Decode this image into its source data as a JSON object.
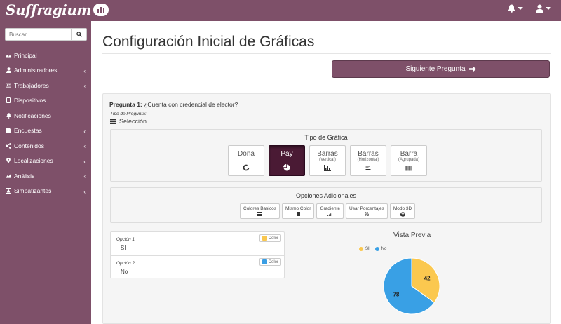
{
  "app": {
    "name": "Suffragium"
  },
  "sidebar": {
    "search_placeholder": "Buscar...",
    "items": [
      {
        "label": "Principal",
        "icon": "dashboard-icon",
        "submenu": false
      },
      {
        "label": "Administradores",
        "icon": "user-icon",
        "submenu": true
      },
      {
        "label": "Trabajadores",
        "icon": "id-card-icon",
        "submenu": true
      },
      {
        "label": "Dispositivos",
        "icon": "tablet-icon",
        "submenu": false
      },
      {
        "label": "Notificaciones",
        "icon": "bell-icon",
        "submenu": false
      },
      {
        "label": "Encuestas",
        "icon": "file-icon",
        "submenu": true
      },
      {
        "label": "Contenidos",
        "icon": "share-icon",
        "submenu": true
      },
      {
        "label": "Localizaciones",
        "icon": "map-marker-icon",
        "submenu": true
      },
      {
        "label": "Análisis",
        "icon": "area-chart-icon",
        "submenu": true
      },
      {
        "label": "Simpatizantes",
        "icon": "contact-card-icon",
        "submenu": true
      }
    ]
  },
  "main": {
    "title": "Configuración Inicial de Gráficas",
    "next_button": "Siguiente Pregunta",
    "question": {
      "prefix": "Pregunta 1:",
      "text": "¿Cuenta con credencial de elector?",
      "type_label": "Tipo de Pregunta:",
      "type_value": "Selección"
    },
    "chart_type": {
      "title": "Tipo de Gráfica",
      "options": [
        {
          "name": "Dona",
          "sub": "",
          "icon": "donut-icon",
          "active": false
        },
        {
          "name": "Pay",
          "sub": "",
          "icon": "pie-icon",
          "active": true
        },
        {
          "name": "Barras",
          "sub": "(Vertical)",
          "icon": "bar-vertical-icon",
          "active": false
        },
        {
          "name": "Barras",
          "sub": "(Horizontal)",
          "icon": "bar-horizontal-icon",
          "active": false
        },
        {
          "name": "Barra",
          "sub": "(Agrupada)",
          "icon": "bar-grouped-icon",
          "active": false
        }
      ]
    },
    "additional": {
      "title": "Opciones Adicionales",
      "options": [
        {
          "label": "Colores Basicos",
          "icon": "list-icon"
        },
        {
          "label": "Mismo Color",
          "icon": "square-icon"
        },
        {
          "label": "Gradiente",
          "icon": "signal-icon"
        },
        {
          "label": "Usar Porcentajes",
          "icon": "percent-icon"
        },
        {
          "label": "Modo 3D",
          "icon": "cube-icon"
        }
      ]
    },
    "answers": [
      {
        "label": "Opción 1",
        "value": "SI",
        "color_button": "Color",
        "color": "#f9c74f"
      },
      {
        "label": "Opción 2",
        "value": "No",
        "color_button": "Color",
        "color": "#3a9ee4"
      }
    ],
    "preview": {
      "title": "Vista Previa"
    }
  },
  "chart_data": {
    "type": "pie",
    "categories": [
      "SI",
      "No"
    ],
    "values": [
      42,
      78
    ],
    "colors": [
      "#fbc84f",
      "#39a0e5"
    ],
    "legend_position": "top-left",
    "data_labels": true
  }
}
